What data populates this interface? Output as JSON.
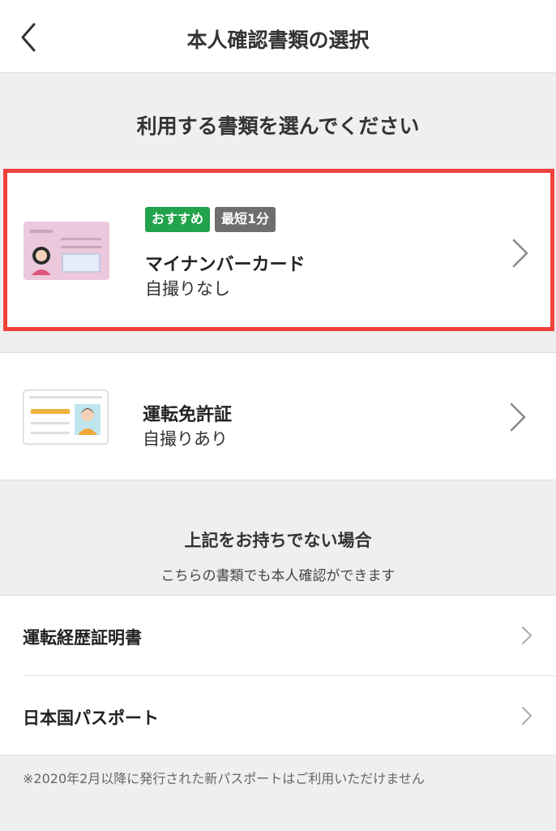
{
  "header": {
    "title": "本人確認書類の選択",
    "back_icon": "chevron-left-icon"
  },
  "section_heading": "利用する書類を選んでください",
  "documents": [
    {
      "badges": [
        "おすすめ",
        "最短1分"
      ],
      "title": "マイナンバーカード",
      "subtitle": "自撮りなし",
      "highlighted": true,
      "badge_colors": [
        "#22a34b",
        "#6e6e6e"
      ]
    },
    {
      "title": "運転免許証",
      "subtitle": "自撮りあり"
    }
  ],
  "alternatives": {
    "heading": "上記をお持ちでない場合",
    "subheading": "こちらの書類でも本人確認ができます",
    "items": [
      {
        "label": "運転経歴証明書"
      },
      {
        "label": "日本国パスポート"
      }
    ]
  },
  "note": "※2020年2月以降に発行された新パスポートはご利用いただけません",
  "colors": {
    "highlight_border": "#f0413b",
    "background": "#efefef"
  }
}
